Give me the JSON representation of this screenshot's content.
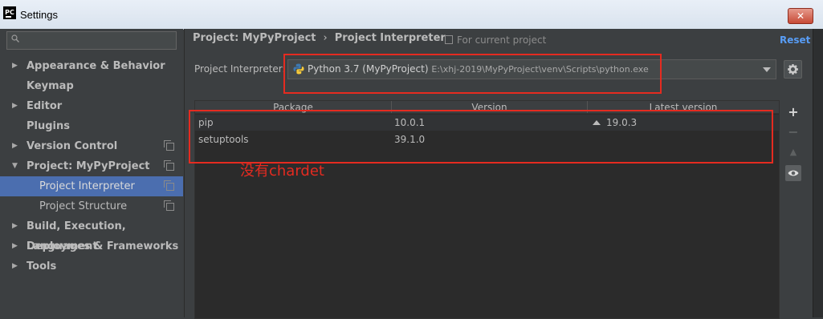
{
  "window": {
    "app_icon_text": "PC",
    "title": "Settings",
    "close_label": "✕"
  },
  "search": {
    "placeholder": ""
  },
  "sidebar": {
    "items": [
      {
        "label": "Appearance & Behavior",
        "arrow": "▶"
      },
      {
        "label": "Keymap"
      },
      {
        "label": "Editor",
        "arrow": "▶"
      },
      {
        "label": "Plugins"
      },
      {
        "label": "Version Control",
        "arrow": "▶"
      },
      {
        "label": "Project: MyPyProject",
        "arrow": "▼"
      },
      {
        "label": "Project Interpreter"
      },
      {
        "label": "Project Structure"
      },
      {
        "label": "Build, Execution, Deployment",
        "arrow": "▶"
      },
      {
        "label": "Languages & Frameworks",
        "arrow": "▶"
      },
      {
        "label": "Tools",
        "arrow": "▶"
      }
    ],
    "selected": "Project Interpreter"
  },
  "header": {
    "breadcrumb_project": "Project: MyPyProject",
    "breadcrumb_separator": "›",
    "breadcrumb_page": "Project Interpreter",
    "scope_note": "For current project",
    "reset_label": "Reset"
  },
  "interpreter": {
    "label": "Project Interpreter:",
    "name": "Python 3.7 (MyPyProject)",
    "path": "E:\\xhj-2019\\MyPyProject\\venv\\Scripts\\python.exe"
  },
  "packages": {
    "columns": [
      "Package",
      "Version",
      "Latest version"
    ],
    "rows": [
      {
        "package": "pip",
        "version": "10.0.1",
        "latest": "19.0.3",
        "upgrade": true
      },
      {
        "package": "setuptools",
        "version": "39.1.0",
        "latest": "",
        "upgrade": false
      }
    ]
  },
  "toolbar": {
    "add_label": "+",
    "remove_label": "−",
    "up_label": "▲"
  },
  "annotation": {
    "text": "没有chardet",
    "color": "#e52b20"
  },
  "colors": {
    "selection": "#4b6eaf",
    "link": "#589df6",
    "background": "#3c3f41"
  }
}
